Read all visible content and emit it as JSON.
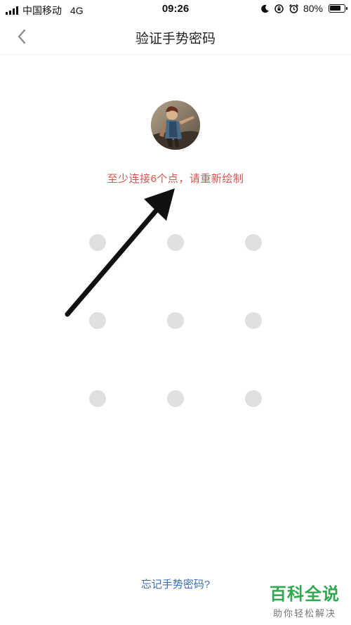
{
  "status_bar": {
    "carrier": "中国移动",
    "network": "4G",
    "time": "09:26",
    "battery": "80%",
    "battery_level": 0.8
  },
  "nav": {
    "back_icon": "chevron-left-icon",
    "title": "验证手势密码"
  },
  "gesture": {
    "avatar_icon": "user-avatar",
    "error_message": "至少连接6个点，请重新绘制",
    "error_color": "#d9534f",
    "dot_color": "#e0e0e2",
    "dots": [
      1,
      2,
      3,
      4,
      5,
      6,
      7,
      8,
      9
    ]
  },
  "footer": {
    "forgot_link": "忘记手势密码?",
    "link_color": "#3b6fb6"
  },
  "watermark": {
    "title": "百科全说",
    "subtitle": "助你轻松解决"
  }
}
